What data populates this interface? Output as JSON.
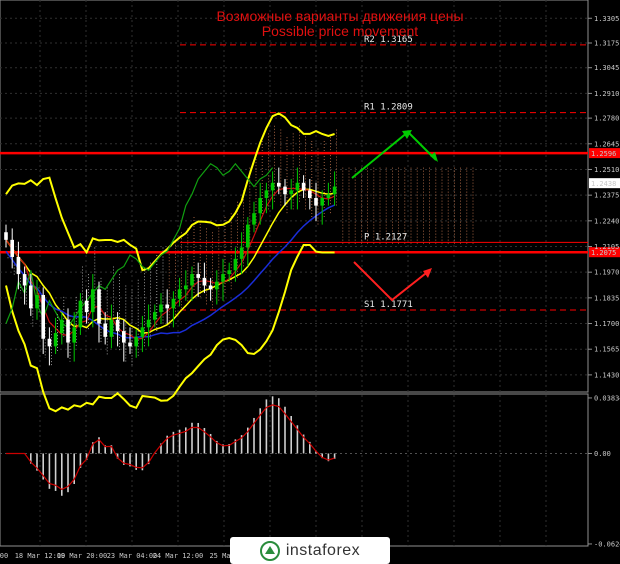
{
  "title": {
    "line1": "Возможные варианты движения цены",
    "line2": "Possible price movement"
  },
  "brand": {
    "name": "instaforex"
  },
  "colors": {
    "background": "#000000",
    "support_resistance": "#ff0000",
    "bollinger": "#ffff00",
    "up_arrow": "#00cc00",
    "down_arrow": "#ff2020",
    "macd_hist": "#d0d0d0",
    "macd_signal": "#cc0000"
  },
  "chart_data": [
    {
      "type": "line",
      "title": "Возможные варианты движения цены / Possible price movement",
      "y_ticks": [
        "1.3305",
        "1.3175",
        "1.3045",
        "1.2910",
        "1.2780",
        "1.2645",
        "1.2510",
        "1.2375",
        "1.2240",
        "1.2105",
        "1.1970",
        "1.1835",
        "1.1700",
        "1.1565",
        "1.1430"
      ],
      "x_ticks": [
        "00",
        "18 Mar 12:00",
        "19 Mar 20:00",
        "23 Mar 04:00",
        "24 Mar 12:00",
        "25 Ma"
      ],
      "ylim": [
        1.134,
        1.338
      ],
      "levels": [
        {
          "label": "R2 1.3165",
          "value": 1.3165,
          "style": "dashed"
        },
        {
          "label": "R1 1.2809",
          "value": 1.2809,
          "style": "dashed"
        },
        {
          "label": "",
          "value": 1.2596,
          "style": "solid",
          "tag": "1.2596"
        },
        {
          "label": "P 1.2127",
          "value": 1.2127,
          "style": "thin"
        },
        {
          "label": "",
          "value": 1.2075,
          "style": "solid",
          "tag": "1.2075"
        },
        {
          "label": "S1 1.1771",
          "value": 1.1771,
          "style": "dashed"
        }
      ],
      "last_price": "1.2438",
      "close_series": [
        1.214,
        1.205,
        1.196,
        1.19,
        1.178,
        1.185,
        1.162,
        1.158,
        1.165,
        1.172,
        1.16,
        1.168,
        1.182,
        1.176,
        1.188,
        1.17,
        1.163,
        1.172,
        1.166,
        1.16,
        1.158,
        1.163,
        1.168,
        1.172,
        1.176,
        1.18,
        1.178,
        1.183,
        1.188,
        1.19,
        1.196,
        1.194,
        1.19,
        1.188,
        1.192,
        1.196,
        1.198,
        1.204,
        1.21,
        1.222,
        1.228,
        1.236,
        1.24,
        1.244,
        1.242,
        1.238,
        1.24,
        1.244,
        1.24,
        1.236,
        1.232,
        1.236,
        1.238,
        1.242
      ]
    },
    {
      "type": "bar",
      "title": "MACD",
      "y_ticks": [
        "0.03834",
        "0.00",
        "-0.06247"
      ],
      "ylim": [
        -0.0625,
        0.0383
      ]
    }
  ]
}
